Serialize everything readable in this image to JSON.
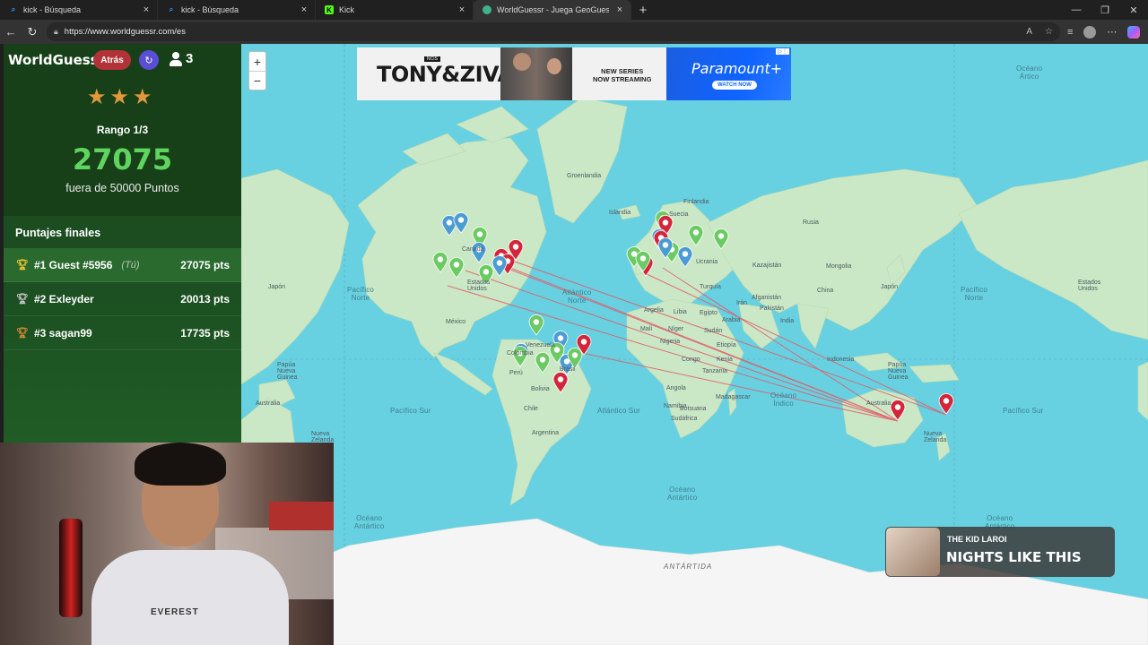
{
  "browser": {
    "tabs": [
      {
        "title": "kick - Búsqueda",
        "icon": "search-icon",
        "active": false
      },
      {
        "title": "kick - Búsqueda",
        "icon": "search-icon",
        "active": false
      },
      {
        "title": "Kick",
        "icon": "kick-icon",
        "active": false
      },
      {
        "title": "WorldGuessr - Juega GeoGuessr gratis",
        "icon": "globe-icon",
        "active": true
      }
    ],
    "url": "https://www.worldguessr.com/es"
  },
  "panel": {
    "logo": "WorldGuessr",
    "back_label": "Atrás",
    "players_count": "3",
    "stars": 3,
    "rank": "Rango 1/3",
    "score": "27075",
    "out_of": "fuera de 50000 Puntos",
    "final_title": "Puntajes finales",
    "leaderboard": [
      {
        "name": "#1 Guest #5956",
        "tag": "(Tú)",
        "pts": "27075 pts",
        "trophy_color": "#f2c230"
      },
      {
        "name": "#2 Exleyder",
        "tag": "",
        "pts": "20013 pts",
        "trophy_color": "#c8c8c8"
      },
      {
        "name": "#3 sagan99",
        "tag": "",
        "pts": "17735 pts",
        "trophy_color": "#d08a3a"
      }
    ]
  },
  "map": {
    "zoom_in": "+",
    "zoom_out": "−",
    "oceans": {
      "artico": "Océano\nÁrtico",
      "pacifico_norte_left": "Pacífico\nNorte",
      "pacifico_norte_right": "Pacífico\nNorte",
      "atlantico_norte": "Atlántico\nNorte",
      "pacifico_sur_left": "Pacífico Sur",
      "pacifico_sur_right": "Pacífico Sur",
      "atlantico_sur": "Atlántico Sur",
      "indico": "Océano\nÍndico",
      "antartico_left": "Océano\nAntártico",
      "antartico_mid": "Océano\nAntártico",
      "antartico_right": "Océano\nAntártico",
      "antartida": "ANTÁRTIDA"
    },
    "labels": {
      "groenlandia": "Groenlandia",
      "islandia": "Islandia",
      "canada": "Canadá",
      "suecia": "Suecia",
      "finlandia": "Finlandia",
      "rusia": "Rusia",
      "kazajistan": "Kazajistán",
      "mongolia": "Mongolia",
      "china": "China",
      "japon_l": "Japón",
      "japon_r": "Japón",
      "india": "India",
      "iran": "Irán",
      "turquia": "Turquía",
      "ucrania": "Ucrania",
      "afganistan": "Afganistán",
      "pakistan": "Pakistán",
      "argelia": "Argelia",
      "libia": "Libia",
      "egipto": "Egipto",
      "arabia": "Arabia",
      "mali": "Malí",
      "niger": "Níger",
      "nigeria": "Nigeria",
      "sudan": "Sudán",
      "etiopia": "Etiopía",
      "kenia": "Kenia",
      "congo": "Congo",
      "tanzania": "Tanzania",
      "angola": "Angola",
      "namibia": "Namibia",
      "botsuana": "Botsuana",
      "sudafrica": "Sudáfrica",
      "madagascar": "Madagascar",
      "mexico": "México",
      "estados_unidos_l": "Estados\nUnidos",
      "estados_unidos_r": "Estados\nUnidos",
      "venezuela": "Venezuela",
      "colombia": "Colombia",
      "peru": "Perú",
      "brasil": "Brasil",
      "bolivia": "Bolivia",
      "argentina": "Argentina",
      "chile": "Chile",
      "indonesia": "Indonesia",
      "papua_l": "Papúa\nNueva\nGuinea",
      "papua_r": "Papúa\nNueva\nGuinea",
      "australia_l": "Australia",
      "australia_r": "Australia",
      "nueva_zelanda_l": "Nueva\nZelanda",
      "nueva_zelanda_r": "Nueva\nZelanda"
    }
  },
  "ad": {
    "brand_line": "TONY&ZIVA",
    "ncis": "NCIS",
    "tagline": "NEW SERIES\nNOW STREAMING",
    "network": "Paramount+",
    "cta": "WATCH NOW"
  },
  "webcam": {
    "shirt_text": "EVEREST"
  },
  "music": {
    "artist": "THE KID LAROI",
    "song": "NIGHTS LIKE THIS"
  },
  "colors": {
    "panel_green": "#1a4a20",
    "score_green": "#5fd45f",
    "map_water": "#68d1e1",
    "land": "#cbe8c6",
    "pin_red": "#d3263a",
    "pin_green": "#6cca63",
    "pin_blue": "#4b9cd3"
  }
}
